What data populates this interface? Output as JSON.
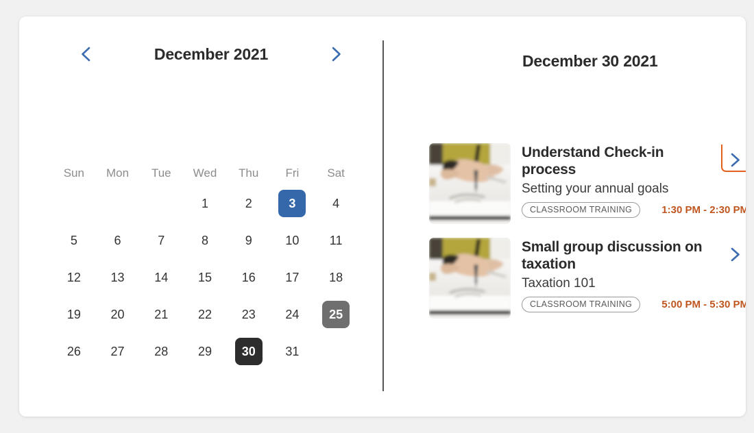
{
  "colors": {
    "page_background": "#f1f1f1",
    "card_background": "#ffffff",
    "accent_blue": "#3568ab",
    "nav_chevron_blue": "#3b6cb0",
    "selected_gray": "#6f6f6f",
    "selected_dark": "#2d2d2d",
    "time_orange": "#c0561f",
    "focus_orange": "#e3611c",
    "divider_gray": "#555555",
    "dow_gray": "#8c8c8c"
  },
  "calendar": {
    "title": "December 2021",
    "prev_label": "Previous month",
    "next_label": "Next month",
    "prev_icon": "chevron-left-icon",
    "next_icon": "chevron-right-icon",
    "day_headers": [
      "Sun",
      "Mon",
      "Tue",
      "Wed",
      "Thu",
      "Fri",
      "Sat"
    ],
    "weeks": [
      [
        {
          "label": "",
          "state": "empty"
        },
        {
          "label": "",
          "state": "empty"
        },
        {
          "label": "",
          "state": "empty"
        },
        {
          "label": "1",
          "state": "normal"
        },
        {
          "label": "2",
          "state": "normal"
        },
        {
          "label": "3",
          "state": "blue"
        },
        {
          "label": "4",
          "state": "normal"
        }
      ],
      [
        {
          "label": "5",
          "state": "normal"
        },
        {
          "label": "6",
          "state": "normal"
        },
        {
          "label": "7",
          "state": "normal"
        },
        {
          "label": "8",
          "state": "normal"
        },
        {
          "label": "9",
          "state": "normal"
        },
        {
          "label": "10",
          "state": "normal"
        },
        {
          "label": "11",
          "state": "normal"
        }
      ],
      [
        {
          "label": "12",
          "state": "normal"
        },
        {
          "label": "13",
          "state": "normal"
        },
        {
          "label": "14",
          "state": "normal"
        },
        {
          "label": "15",
          "state": "normal"
        },
        {
          "label": "16",
          "state": "normal"
        },
        {
          "label": "17",
          "state": "normal"
        },
        {
          "label": "18",
          "state": "normal"
        }
      ],
      [
        {
          "label": "19",
          "state": "normal"
        },
        {
          "label": "20",
          "state": "normal"
        },
        {
          "label": "21",
          "state": "normal"
        },
        {
          "label": "22",
          "state": "normal"
        },
        {
          "label": "23",
          "state": "normal"
        },
        {
          "label": "24",
          "state": "normal"
        },
        {
          "label": "25",
          "state": "gray"
        }
      ],
      [
        {
          "label": "26",
          "state": "normal"
        },
        {
          "label": "27",
          "state": "normal"
        },
        {
          "label": "28",
          "state": "normal"
        },
        {
          "label": "29",
          "state": "normal"
        },
        {
          "label": "30",
          "state": "dark"
        },
        {
          "label": "31",
          "state": "normal"
        },
        {
          "label": "",
          "state": "empty"
        }
      ]
    ]
  },
  "agenda": {
    "title": "December 30 2021",
    "events": [
      {
        "title": "Understand Check-in process",
        "subtitle": "Setting your annual goals",
        "tag": "CLASSROOM TRAINING",
        "time": "1:30 PM - 2:30 PM",
        "thumbnail": "person-writing-photo",
        "chevron_icon": "chevron-right-icon",
        "focused": true
      },
      {
        "title": "Small group discussion on taxation",
        "subtitle": "Taxation 101",
        "tag": "CLASSROOM TRAINING",
        "time": "5:00 PM - 5:30 PM",
        "thumbnail": "person-writing-photo",
        "chevron_icon": "chevron-right-icon",
        "focused": false
      }
    ]
  }
}
